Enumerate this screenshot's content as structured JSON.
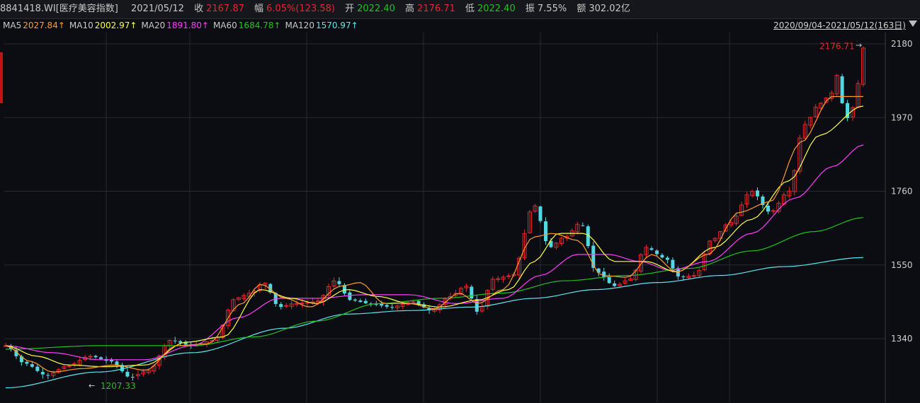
{
  "header": {
    "symbol": "8841418.WI[医疗美容指数]",
    "date": "2021/05/12",
    "close_label": "收",
    "close_value": "2167.87",
    "change_label": "幅",
    "change_value": "6.05%(123.58)",
    "open_label": "开",
    "open_value": "2022.40",
    "high_label": "高",
    "high_value": "2176.71",
    "low_label": "低",
    "low_value": "2022.40",
    "amp_label": "振",
    "amp_value": "7.55%",
    "amount_label": "额",
    "amount_value": "302.02亿"
  },
  "legend": [
    {
      "name": "MA5",
      "value": "2027.84↑",
      "color": "#ff9b2e"
    },
    {
      "name": "MA10",
      "value": "2002.97↑",
      "color": "#ffff44"
    },
    {
      "name": "MA20",
      "value": "1891.80↑",
      "color": "#ff3cff"
    },
    {
      "name": "MA60",
      "value": "1684.78↑",
      "color": "#21c21e"
    },
    {
      "name": "MA120",
      "value": "1570.97↑",
      "color": "#5ee6f0"
    }
  ],
  "range_text": "2020/09/04-2021/05/12(163日)",
  "chart_data": {
    "type": "candlestick",
    "y_ticks": [
      "2180",
      "1970",
      "1760",
      "1550",
      "1340"
    ],
    "ylim": [
      1240,
      2200
    ],
    "grid": true,
    "bars": 163,
    "colors": {
      "up": "#e8262b",
      "down": "#55d6e3",
      "grid": "#262a31"
    },
    "close_anchors": [
      [
        0,
        1320
      ],
      [
        6,
        1270
      ],
      [
        13,
        1236
      ],
      [
        20,
        1262
      ],
      [
        27,
        1290
      ],
      [
        34,
        1275
      ],
      [
        40,
        1230
      ],
      [
        46,
        1250
      ],
      [
        53,
        1335
      ],
      [
        60,
        1320
      ],
      [
        67,
        1335
      ],
      [
        74,
        1455
      ],
      [
        79,
        1470
      ],
      [
        83,
        1500
      ],
      [
        88,
        1430
      ],
      [
        93,
        1440
      ],
      [
        100,
        1445
      ],
      [
        106,
        1505
      ],
      [
        111,
        1450
      ],
      [
        117,
        1440
      ],
      [
        124,
        1430
      ],
      [
        131,
        1445
      ],
      [
        137,
        1420
      ],
      [
        143,
        1460
      ],
      [
        148,
        1490
      ],
      [
        152,
        1415
      ],
      [
        157,
        1510
      ],
      [
        163,
        1520
      ],
      [
        170,
        1720
      ],
      [
        175,
        1600
      ],
      [
        180,
        1630
      ],
      [
        185,
        1670
      ],
      [
        190,
        1530
      ],
      [
        196,
        1490
      ],
      [
        201,
        1510
      ],
      [
        206,
        1600
      ],
      [
        212,
        1570
      ],
      [
        217,
        1515
      ],
      [
        222,
        1520
      ],
      [
        227,
        1620
      ],
      [
        233,
        1670
      ],
      [
        240,
        1760
      ],
      [
        246,
        1700
      ],
      [
        252,
        1760
      ],
      [
        257,
        1950
      ],
      [
        262,
        2010
      ],
      [
        266,
        2040
      ],
      [
        268,
        2100
      ],
      [
        270,
        1960
      ],
      [
        273,
        2000
      ],
      [
        276,
        2168
      ]
    ],
    "ma5_anchors": [
      [
        0,
        1320
      ],
      [
        8,
        1275
      ],
      [
        15,
        1245
      ],
      [
        25,
        1255
      ],
      [
        35,
        1265
      ],
      [
        45,
        1250
      ],
      [
        55,
        1320
      ],
      [
        65,
        1325
      ],
      [
        76,
        1440
      ],
      [
        82,
        1495
      ],
      [
        90,
        1455
      ],
      [
        98,
        1430
      ],
      [
        108,
        1490
      ],
      [
        114,
        1500
      ],
      [
        122,
        1440
      ],
      [
        130,
        1440
      ],
      [
        138,
        1425
      ],
      [
        146,
        1470
      ],
      [
        152,
        1440
      ],
      [
        160,
        1480
      ],
      [
        170,
        1630
      ],
      [
        176,
        1640
      ],
      [
        184,
        1620
      ],
      [
        192,
        1520
      ],
      [
        200,
        1515
      ],
      [
        208,
        1580
      ],
      [
        216,
        1530
      ],
      [
        226,
        1580
      ],
      [
        236,
        1700
      ],
      [
        246,
        1730
      ],
      [
        256,
        1900
      ],
      [
        266,
        2030
      ],
      [
        276,
        2030
      ]
    ],
    "ma10_anchors": [
      [
        0,
        1320
      ],
      [
        10,
        1290
      ],
      [
        20,
        1265
      ],
      [
        32,
        1260
      ],
      [
        45,
        1265
      ],
      [
        58,
        1330
      ],
      [
        70,
        1345
      ],
      [
        82,
        1480
      ],
      [
        92,
        1455
      ],
      [
        100,
        1440
      ],
      [
        110,
        1480
      ],
      [
        120,
        1460
      ],
      [
        130,
        1440
      ],
      [
        140,
        1430
      ],
      [
        152,
        1450
      ],
      [
        162,
        1480
      ],
      [
        170,
        1560
      ],
      [
        178,
        1640
      ],
      [
        186,
        1640
      ],
      [
        196,
        1560
      ],
      [
        206,
        1560
      ],
      [
        216,
        1530
      ],
      [
        228,
        1600
      ],
      [
        240,
        1680
      ],
      [
        252,
        1790
      ],
      [
        262,
        1920
      ],
      [
        276,
        2003
      ]
    ],
    "ma20_anchors": [
      [
        0,
        1320
      ],
      [
        15,
        1300
      ],
      [
        30,
        1280
      ],
      [
        45,
        1280
      ],
      [
        60,
        1320
      ],
      [
        75,
        1400
      ],
      [
        88,
        1455
      ],
      [
        100,
        1455
      ],
      [
        115,
        1465
      ],
      [
        130,
        1465
      ],
      [
        145,
        1440
      ],
      [
        160,
        1455
      ],
      [
        172,
        1520
      ],
      [
        184,
        1580
      ],
      [
        194,
        1580
      ],
      [
        204,
        1560
      ],
      [
        214,
        1535
      ],
      [
        226,
        1560
      ],
      [
        240,
        1640
      ],
      [
        254,
        1740
      ],
      [
        266,
        1830
      ],
      [
        276,
        1892
      ]
    ],
    "ma60_anchors": [
      [
        0,
        1310
      ],
      [
        30,
        1320
      ],
      [
        60,
        1320
      ],
      [
        80,
        1345
      ],
      [
        100,
        1390
      ],
      [
        120,
        1440
      ],
      [
        140,
        1455
      ],
      [
        160,
        1470
      ],
      [
        180,
        1505
      ],
      [
        200,
        1520
      ],
      [
        220,
        1540
      ],
      [
        240,
        1590
      ],
      [
        260,
        1645
      ],
      [
        276,
        1685
      ]
    ],
    "ma120_anchors": [
      [
        0,
        1200
      ],
      [
        30,
        1245
      ],
      [
        60,
        1300
      ],
      [
        90,
        1370
      ],
      [
        110,
        1410
      ],
      [
        130,
        1420
      ],
      [
        150,
        1430
      ],
      [
        170,
        1455
      ],
      [
        190,
        1480
      ],
      [
        210,
        1500
      ],
      [
        230,
        1520
      ],
      [
        250,
        1545
      ],
      [
        276,
        1571
      ]
    ],
    "annotations": [
      {
        "text": "2176.71",
        "arrow": "→",
        "at": "high",
        "color": "#e8262b"
      },
      {
        "text": "1207.33",
        "arrow": "←",
        "at": "low",
        "color": "#21c21e"
      }
    ]
  }
}
